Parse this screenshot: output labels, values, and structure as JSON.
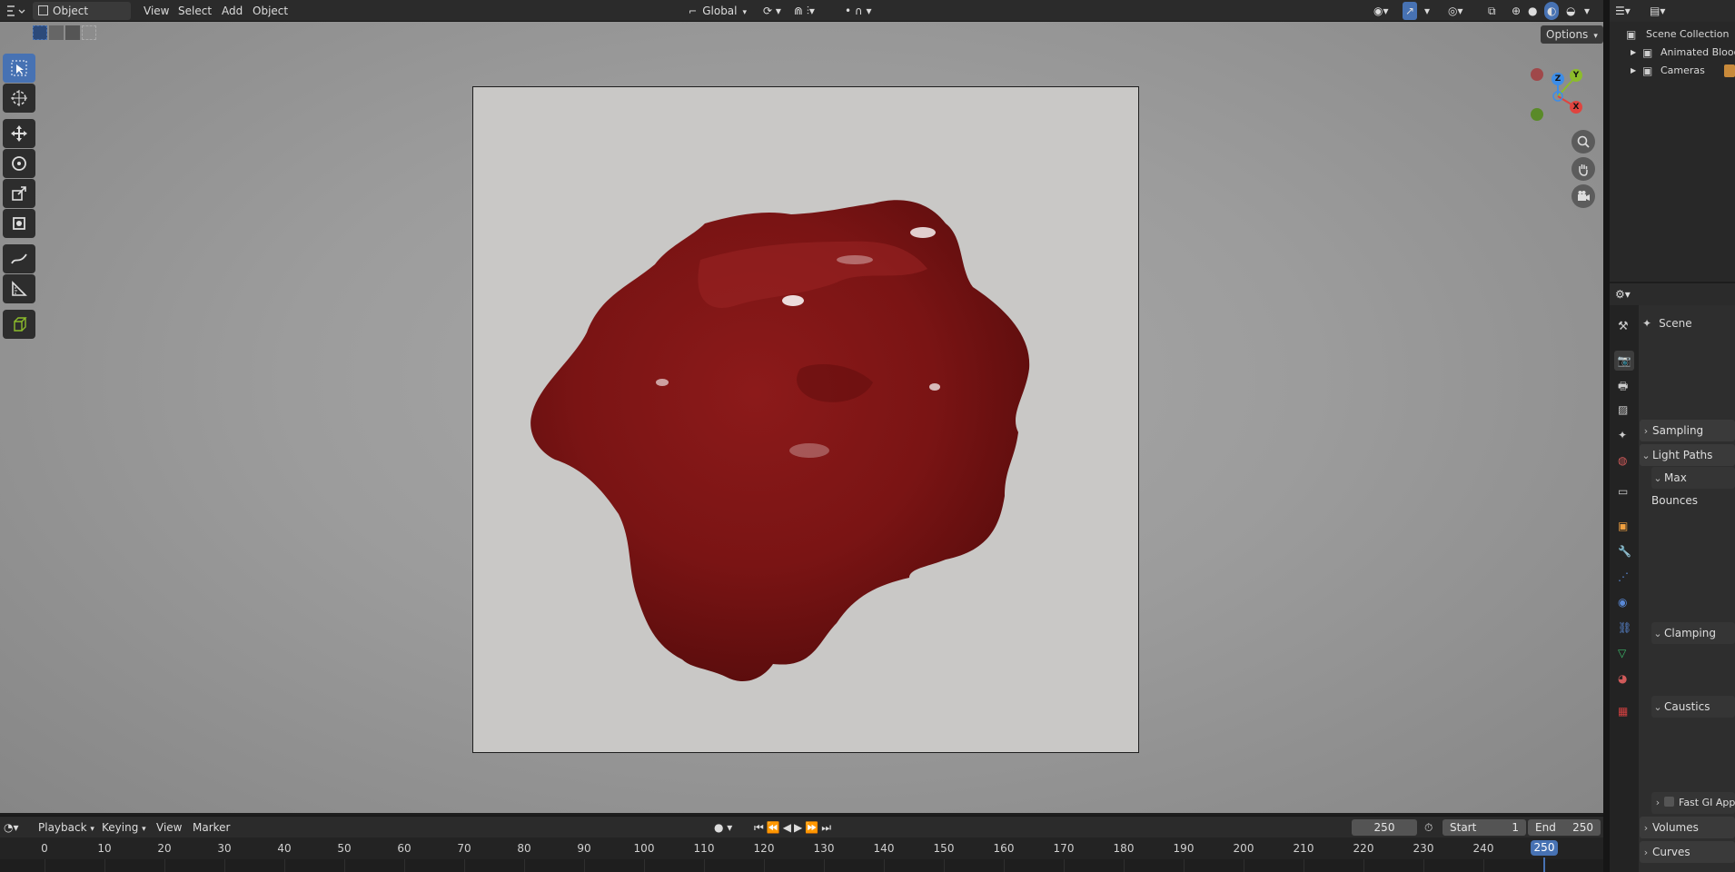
{
  "header": {
    "mode": "Object Mode",
    "menus": [
      "View",
      "Select",
      "Add",
      "Object"
    ],
    "transform_orientation": "Global"
  },
  "subheader": {
    "options_label": "Options"
  },
  "gizmo": {
    "z": "Z",
    "y": "Y",
    "x": "X"
  },
  "outliner": {
    "title": "Scene Collection",
    "items": [
      "Animated Blood",
      "Cameras"
    ]
  },
  "properties": {
    "scene_label": "Scene",
    "panels": {
      "sampling": "Sampling",
      "light_paths": "Light Paths",
      "max_bounces": "Max Bounces",
      "clamping": "Clamping",
      "caustics": "Caustics",
      "fast_gi": "Fast GI Approximation",
      "volumes": "Volumes",
      "curves": "Curves"
    }
  },
  "timeline": {
    "menus": [
      "Playback",
      "Keying",
      "View",
      "Marker"
    ],
    "current_frame": "250",
    "start_label": "Start",
    "start_value": "1",
    "end_label": "End",
    "end_value": "250",
    "ticks": [
      "0",
      "10",
      "20",
      "30",
      "40",
      "50",
      "60",
      "70",
      "80",
      "90",
      "100",
      "110",
      "120",
      "130",
      "140",
      "150",
      "160",
      "170",
      "180",
      "190",
      "200",
      "210",
      "220",
      "230",
      "240"
    ],
    "playhead_label": "250"
  },
  "colors": {
    "accent": "#4772b3",
    "blood": "#7a1414",
    "axis_x": "#e0443f",
    "axis_y": "#8cbc2b",
    "axis_z": "#3d8de8"
  }
}
